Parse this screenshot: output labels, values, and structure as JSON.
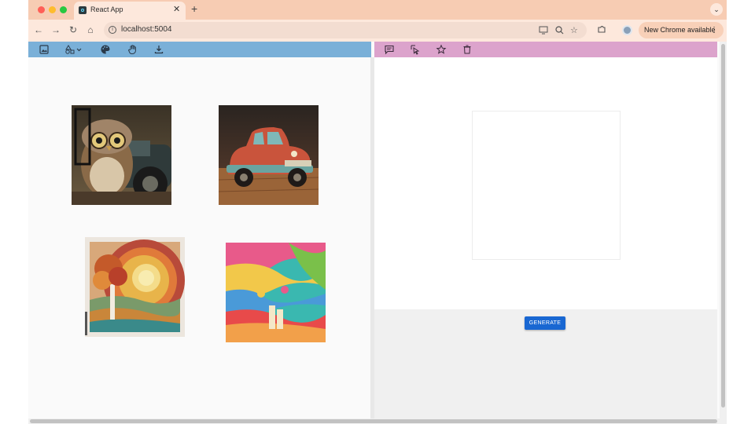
{
  "browser": {
    "tab_title": "React App",
    "tab_close": "✕",
    "new_tab": "+",
    "tab_menu": "⌄",
    "url": "localhost:5004",
    "update_label": "New Chrome available",
    "kebab": "⋮",
    "nav": {
      "back": "←",
      "forward": "→",
      "reload": "↻",
      "home": "⌂"
    },
    "traffic_colors": [
      "#ff5f57",
      "#febc2e",
      "#28c840"
    ]
  },
  "left_toolbar": {
    "color": "#7ab0d8",
    "icons": [
      "image-icon",
      "shapes-dropdown-icon",
      "palette-icon",
      "hand-pan-icon",
      "download-icon"
    ]
  },
  "right_toolbar": {
    "color": "#dca3cc",
    "icons": [
      "comment-icon",
      "select-cursor-icon",
      "star-icon",
      "delete-icon"
    ]
  },
  "gallery": [
    {
      "name": "owl-driving-car-image",
      "description_icon": "owl"
    },
    {
      "name": "red-toy-car-image",
      "description_icon": "car"
    },
    {
      "name": "paper-cut-tree-sunset-image",
      "description_icon": "tree"
    },
    {
      "name": "colorful-abstract-waves-image",
      "description_icon": "waves"
    }
  ],
  "generate_button": {
    "label": "GENERATE",
    "color": "#1967d2"
  }
}
